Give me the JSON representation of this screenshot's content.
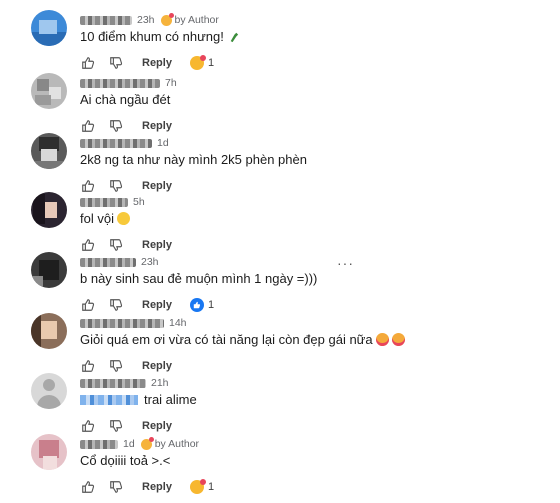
{
  "comments": [
    {
      "time": "23h",
      "author_badge": "by Author",
      "text": "10 điểm khum có nhưng!",
      "text_emoji": "wine-bottle",
      "reply_label": "Reply",
      "reaction": "care-emoji",
      "reaction_count": "1"
    },
    {
      "time": "7h",
      "text": "Ai chà ngầu đét",
      "reply_label": "Reply"
    },
    {
      "time": "1d",
      "text": "2k8 ng ta như này mình 2k5 phèn phèn",
      "reply_label": "Reply"
    },
    {
      "time": "5h",
      "text": "fol vội",
      "text_emoji": "hugging-face",
      "reply_label": "Reply"
    },
    {
      "time": "23h",
      "text": "b này sinh sau đẻ muộn mình 1 ngày =)))",
      "reply_label": "Reply",
      "reaction": "like",
      "reaction_count": "1",
      "more": "···"
    },
    {
      "time": "14h",
      "text": "Giỏi quá em ơi vừa có tài năng lại còn đẹp gái nữa",
      "text_emoji": "smiling-face-with-hearts",
      "reply_label": "Reply"
    },
    {
      "time": "21h",
      "text": "trai alime",
      "reply_label": "Reply"
    },
    {
      "time": "1d",
      "author_badge": "by Author",
      "text": "Cổ dọiiii toả >.<",
      "reply_label": "Reply",
      "reaction": "care-emoji",
      "reaction_count": "1"
    }
  ],
  "colors": {
    "accent": "#1877f2",
    "muted": "#65676b"
  }
}
